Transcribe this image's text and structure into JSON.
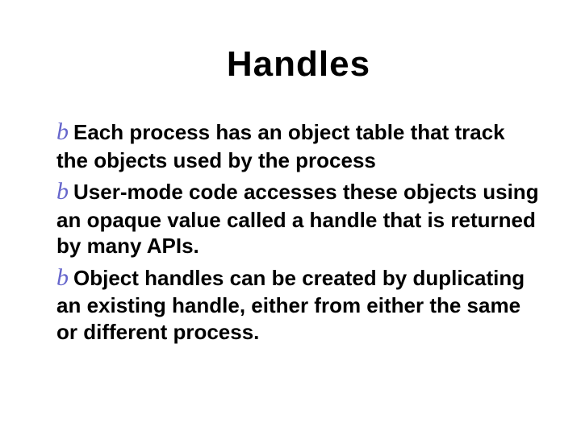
{
  "title": "Handles",
  "bullet_glyph": "b",
  "bullets": [
    "Each process has an object table that track the objects used by the process",
    "User-mode code accesses these objects using an opaque value called a handle that is returned by many APIs.",
    "Object handles can be created by duplicating an existing handle, either from either the same or different process."
  ]
}
